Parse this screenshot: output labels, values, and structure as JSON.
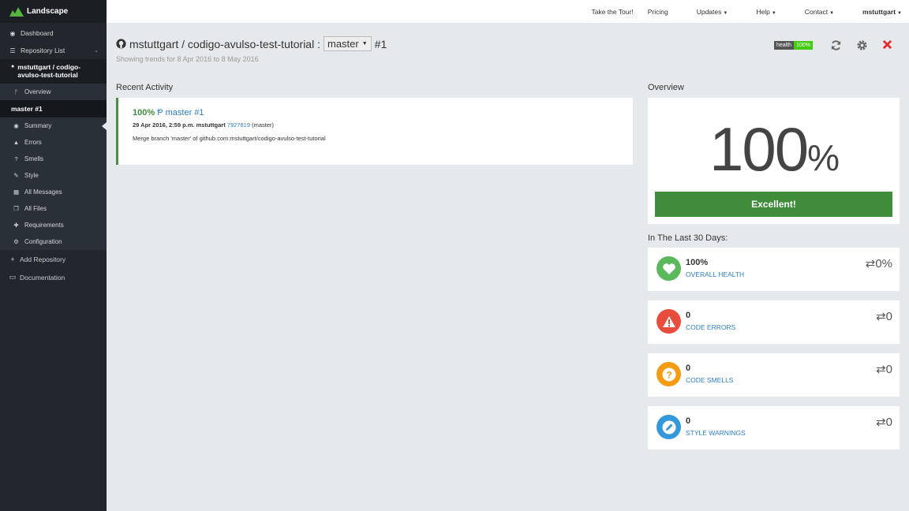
{
  "brand": {
    "name": "Landscape"
  },
  "sidebar": {
    "dashboard": "Dashboard",
    "repo_list": "Repository List",
    "repo_name": "mstuttgart / codigo-avulso-test-tutorial",
    "overview": "Overview",
    "master": "master #1",
    "items": [
      {
        "label": "Summary",
        "icon": "eye-icon"
      },
      {
        "label": "Errors",
        "icon": "warning-icon"
      },
      {
        "label": "Smells",
        "icon": "question-icon"
      },
      {
        "label": "Style",
        "icon": "pencil-icon"
      },
      {
        "label": "All Messages",
        "icon": "table-icon"
      },
      {
        "label": "All Files",
        "icon": "files-icon"
      },
      {
        "label": "Requirements",
        "icon": "pin-icon"
      },
      {
        "label": "Configuration",
        "icon": "cogs-icon"
      }
    ],
    "add_repo": "Add Repository",
    "docs": "Documentation"
  },
  "topbar": {
    "tour": "Take the Tour!",
    "pricing": "Pricing",
    "updates": "Updates",
    "help": "Help",
    "contact": "Contact",
    "user": "mstuttgart"
  },
  "header": {
    "repo": "mstuttgart / codigo-avulso-test-tutorial :",
    "branch": "master",
    "build": "#1",
    "subtitle": "Showing trends for 8 Apr 2016 to 8 May 2016"
  },
  "badge": {
    "label": "health",
    "value": "100%"
  },
  "recent": {
    "title": "Recent Activity",
    "pct": "100%",
    "branch": "master #1",
    "date": "29 Apr 2016, 2:59 p.m.",
    "author": "mstuttgart",
    "sha": "7927819",
    "ref": "(master)",
    "message": "Merge branch 'master' of github.com:mstuttgart/codigo-avulso-test-tutorial"
  },
  "overview": {
    "title": "Overview",
    "value": "100",
    "symbol": "%",
    "rating": "Excellent!"
  },
  "last30": {
    "title": "In The Last 30 Days:",
    "stats": [
      {
        "value": "100%",
        "label": "OVERALL HEALTH",
        "delta": "0%",
        "color": "#5cb85c"
      },
      {
        "value": "0",
        "label": "CODE ERRORS",
        "delta": "0",
        "color": "#e74c3c"
      },
      {
        "value": "0",
        "label": "CODE SMELLS",
        "delta": "0",
        "color": "#f39c12"
      },
      {
        "value": "0",
        "label": "STYLE WARNINGS",
        "delta": "0",
        "color": "#3498db"
      }
    ]
  }
}
